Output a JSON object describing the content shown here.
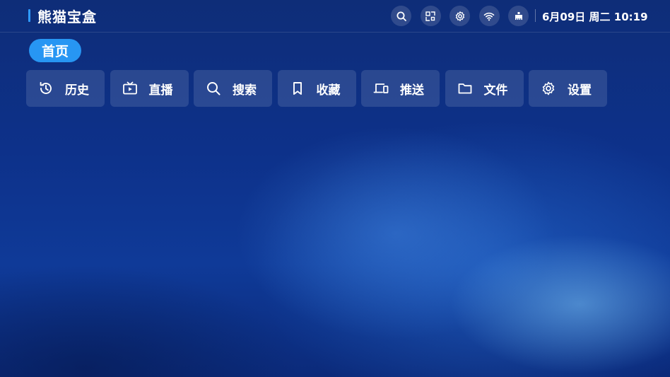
{
  "header": {
    "app_title": "熊猫宝盒",
    "datetime": "6月09日 周二 10:19",
    "status_icons": [
      {
        "name": "search-icon"
      },
      {
        "name": "cast-icon"
      },
      {
        "name": "settings-icon"
      },
      {
        "name": "wifi-icon"
      },
      {
        "name": "ethernet-icon"
      }
    ]
  },
  "tabs": {
    "home_label": "首页"
  },
  "menu": {
    "items": [
      {
        "label": "历史",
        "icon": "history-icon"
      },
      {
        "label": "直播",
        "icon": "live-tv-icon"
      },
      {
        "label": "搜索",
        "icon": "search-icon"
      },
      {
        "label": "收藏",
        "icon": "bookmark-icon"
      },
      {
        "label": "推送",
        "icon": "push-devices-icon"
      },
      {
        "label": "文件",
        "icon": "folder-icon"
      },
      {
        "label": "设置",
        "icon": "settings-icon"
      }
    ]
  },
  "colors": {
    "accent": "#2796f3",
    "title_bar": "#2f9bff",
    "background": "#0d318a"
  }
}
